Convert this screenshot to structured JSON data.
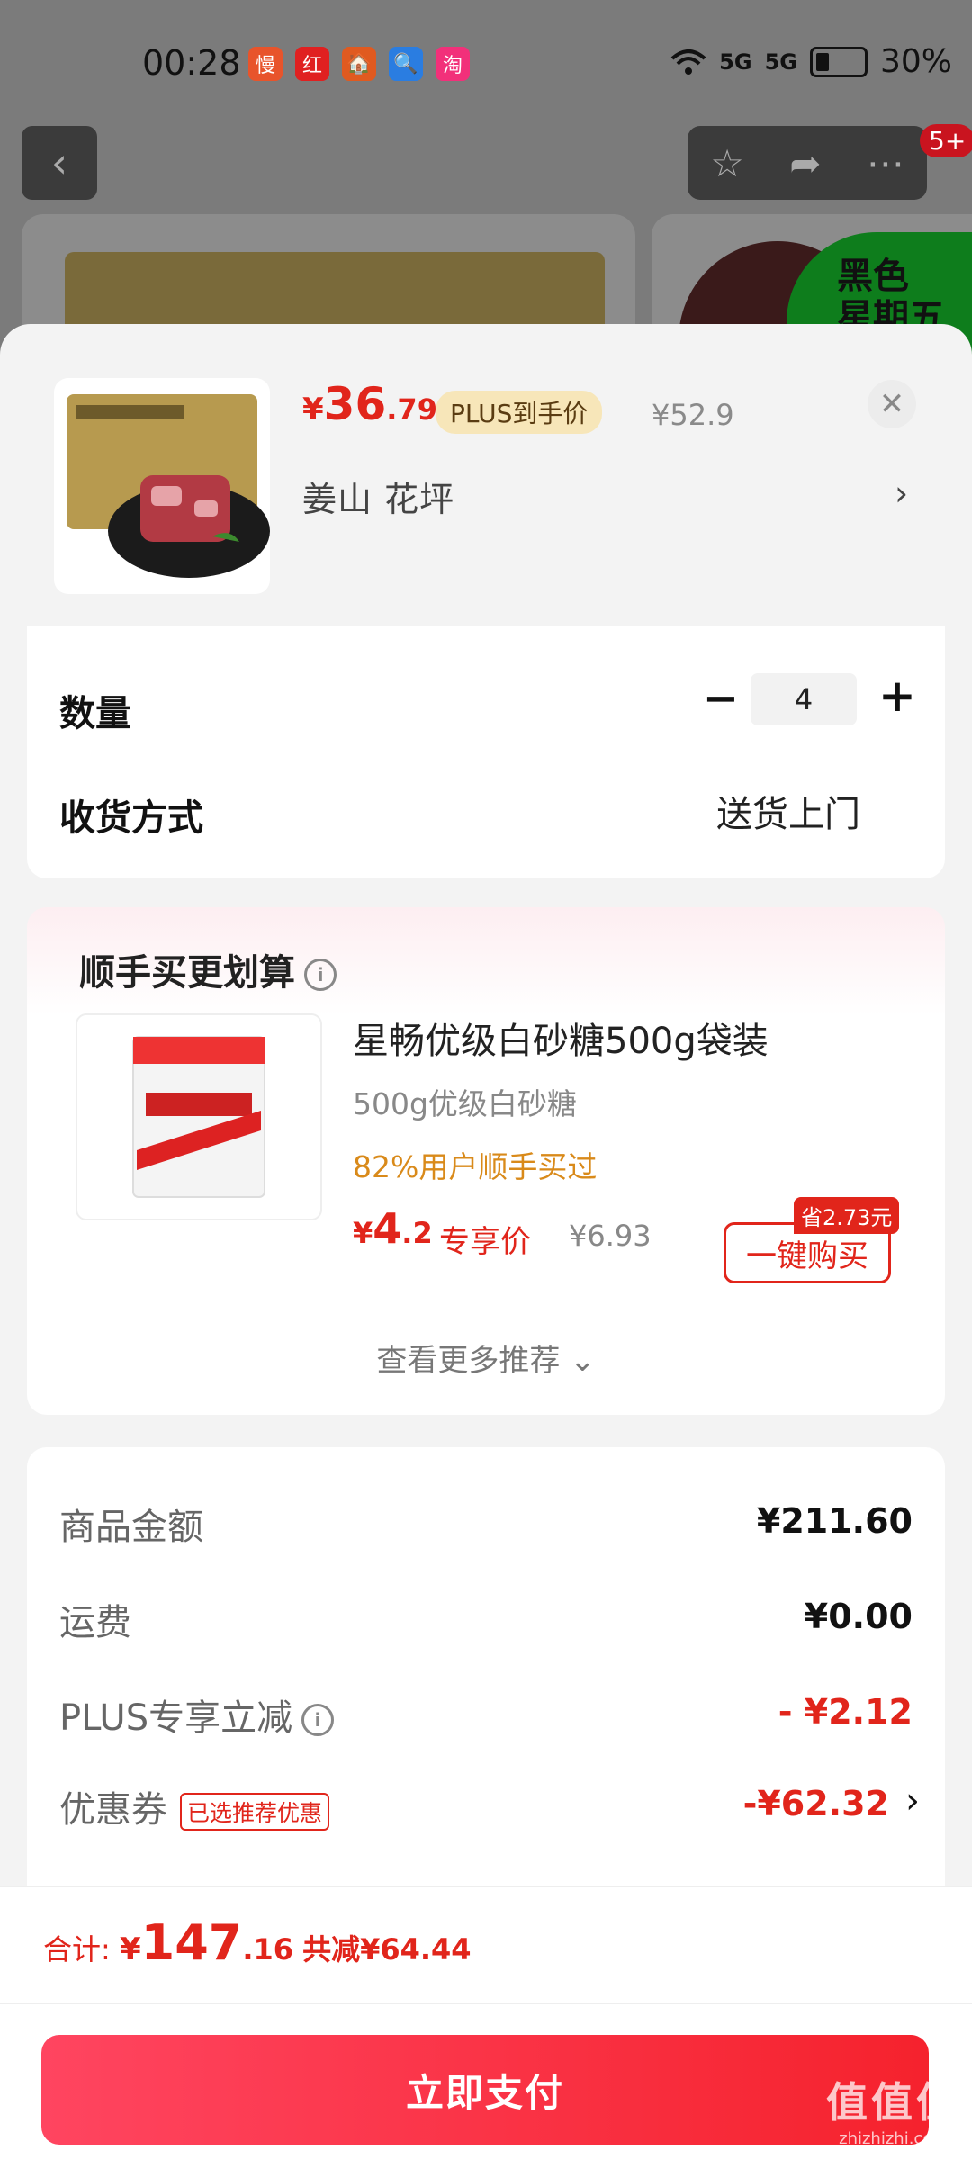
{
  "status_bar": {
    "time": "00:28",
    "apps": [
      {
        "icon": "慢",
        "color": "#e8542b"
      },
      {
        "icon": "红",
        "color": "#e02020"
      },
      {
        "icon": "🏠",
        "color": "#e05a20"
      },
      {
        "icon": "🔍",
        "color": "#2a7de1"
      },
      {
        "icon": "淘",
        "color": "#f2307a"
      }
    ],
    "sig1": "5G",
    "sig2": "5G",
    "battery": "30%"
  },
  "background": {
    "badge": "5+",
    "banner_text_line1": "黑色",
    "banner_text_line2": "星期五"
  },
  "product": {
    "price_symbol": "¥",
    "price_int": "36",
    "price_dec": ".79",
    "plus_tag": "PLUS到手价",
    "orig_price": "¥52.9",
    "spec": "姜山  花坪",
    "close": "✕"
  },
  "order": {
    "qty_label": "数量",
    "qty_minus": "−",
    "qty_value": "4",
    "qty_plus": "+",
    "delivery_label": "收货方式",
    "delivery_value": "送货上门"
  },
  "recommend": {
    "title": "顺手买更划算",
    "item_name": "星畅优级白砂糖500g袋装",
    "item_spec": "500g优级白砂糖",
    "item_bought": "82%用户顺手买过",
    "price_symbol": "¥",
    "price_int": "4",
    "price_dec": ".2",
    "exclusive": "专享价",
    "orig_price": "¥6.93",
    "buy_button": "一键购买",
    "save_badge": "省2.73元",
    "more": "查看更多推荐 ⌄"
  },
  "summary": {
    "goods_label": "商品金额",
    "goods_value": "¥211.60",
    "shipping_label": "运费",
    "shipping_value": "¥0.00",
    "plus_label": "PLUS专享立减",
    "plus_value": "- ¥2.12",
    "coupon_label": "优惠券",
    "coupon_tag": "已选推荐优惠",
    "coupon_value": "-¥62.32"
  },
  "footer": {
    "total_label": "合计: ",
    "total_symbol": "¥",
    "total_int": "147",
    "total_dec": ".16",
    "total_saved": "共减¥64.44",
    "pay_button": "立即支付"
  },
  "watermark": {
    "line1": "值值值",
    "line2": "zhizhizhi.com"
  }
}
